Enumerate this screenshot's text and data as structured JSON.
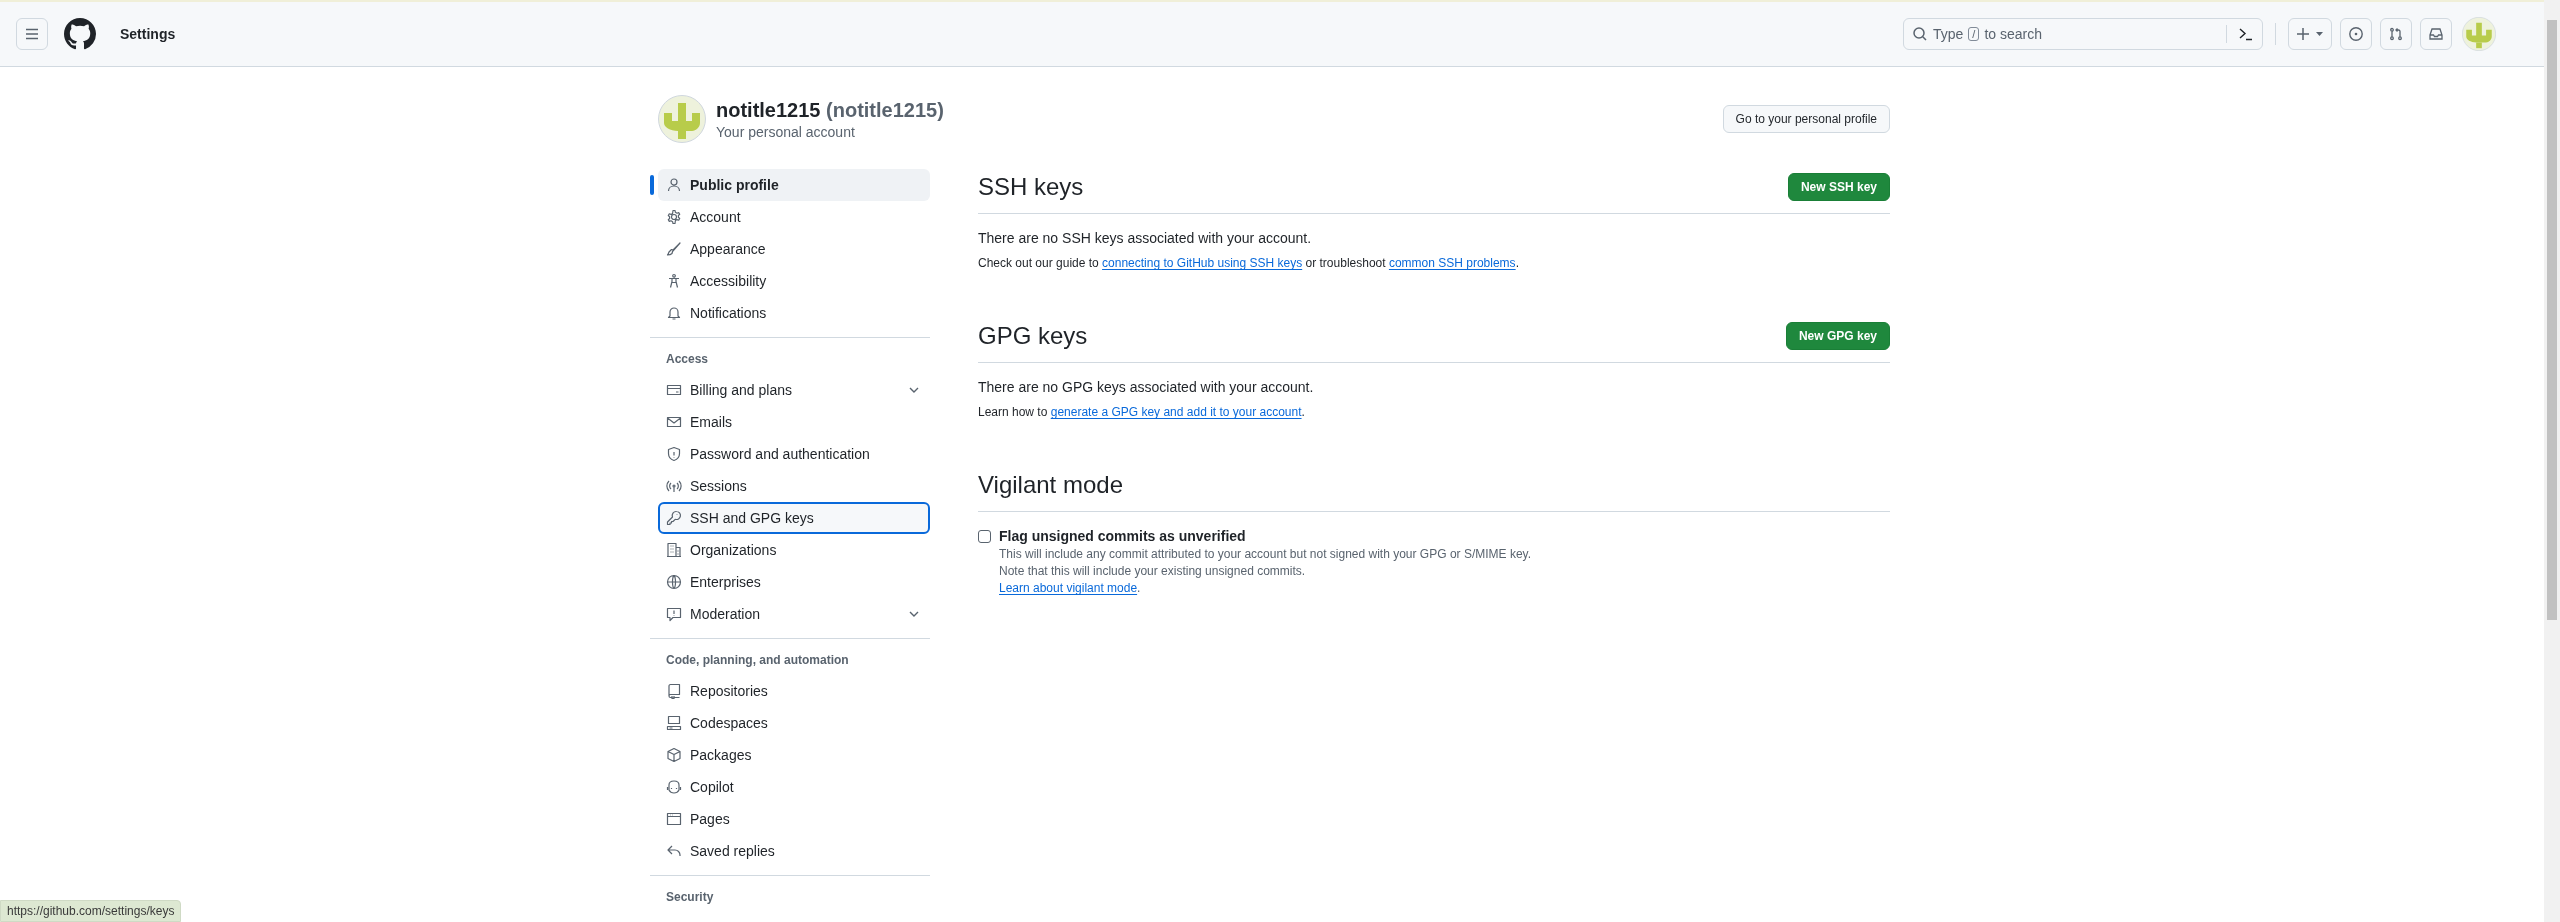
{
  "header": {
    "title": "Settings",
    "search": {
      "placeholder_before": "Type",
      "key": "/",
      "placeholder_after": "to search"
    }
  },
  "account": {
    "name": "notitle1215",
    "login": "(notitle1215)",
    "subtitle": "Your personal account",
    "profile_button": "Go to your personal profile"
  },
  "sidebar": {
    "sections": [
      {
        "items": [
          {
            "label": "Public profile",
            "selected": true,
            "focused": false,
            "kind": "link"
          },
          {
            "label": "Account",
            "selected": false,
            "focused": false,
            "kind": "link"
          },
          {
            "label": "Appearance",
            "selected": false,
            "focused": false,
            "kind": "link"
          },
          {
            "label": "Accessibility",
            "selected": false,
            "focused": false,
            "kind": "link"
          },
          {
            "label": "Notifications",
            "selected": false,
            "focused": false,
            "kind": "link"
          }
        ]
      },
      {
        "heading": "Access",
        "items": [
          {
            "label": "Billing and plans",
            "selected": false,
            "focused": false,
            "kind": "group"
          },
          {
            "label": "Emails",
            "selected": false,
            "focused": false,
            "kind": "link"
          },
          {
            "label": "Password and authentication",
            "selected": false,
            "focused": false,
            "kind": "link"
          },
          {
            "label": "Sessions",
            "selected": false,
            "focused": false,
            "kind": "link"
          },
          {
            "label": "SSH and GPG keys",
            "selected": false,
            "focused": true,
            "kind": "link"
          },
          {
            "label": "Organizations",
            "selected": false,
            "focused": false,
            "kind": "link"
          },
          {
            "label": "Enterprises",
            "selected": false,
            "focused": false,
            "kind": "link"
          },
          {
            "label": "Moderation",
            "selected": false,
            "focused": false,
            "kind": "group"
          }
        ]
      },
      {
        "heading": "Code, planning, and automation",
        "items": [
          {
            "label": "Repositories",
            "selected": false,
            "focused": false,
            "kind": "link"
          },
          {
            "label": "Codespaces",
            "selected": false,
            "focused": false,
            "kind": "link"
          },
          {
            "label": "Packages",
            "selected": false,
            "focused": false,
            "kind": "link"
          },
          {
            "label": "Copilot",
            "selected": false,
            "focused": false,
            "kind": "link"
          },
          {
            "label": "Pages",
            "selected": false,
            "focused": false,
            "kind": "link"
          },
          {
            "label": "Saved replies",
            "selected": false,
            "focused": false,
            "kind": "link"
          }
        ]
      },
      {
        "heading": "Security"
      }
    ]
  },
  "sections": [
    {
      "title": "SSH keys",
      "button": "New SSH key",
      "empty": "There are no SSH keys associated with your account.",
      "help": [
        {
          "text": "Check out our guide to ",
          "link": false
        },
        {
          "text": "connecting to GitHub using SSH keys",
          "link": true
        },
        {
          "text": " or troubleshoot ",
          "link": false
        },
        {
          "text": "common SSH problems",
          "link": true
        },
        {
          "text": ".",
          "link": false
        }
      ]
    },
    {
      "title": "GPG keys",
      "button": "New GPG key",
      "empty": "There are no GPG keys associated with your account.",
      "help": [
        {
          "text": "Learn how to ",
          "link": false
        },
        {
          "text": "generate a GPG key and add it to your account",
          "link": true
        },
        {
          "text": ".",
          "link": false
        }
      ]
    }
  ],
  "vigilant": {
    "title": "Vigilant mode",
    "option": {
      "label": "Flag unsigned commits as unverified",
      "checked": false
    },
    "notes": [
      "This will include any commit attributed to your account but not signed with your GPG or S/MIME key.",
      "Note that this will include your existing unsigned commits."
    ],
    "link": "Learn about vigilant mode",
    "link_suffix": "."
  },
  "status_bar": {
    "url": "https://github.com/settings/keys"
  }
}
